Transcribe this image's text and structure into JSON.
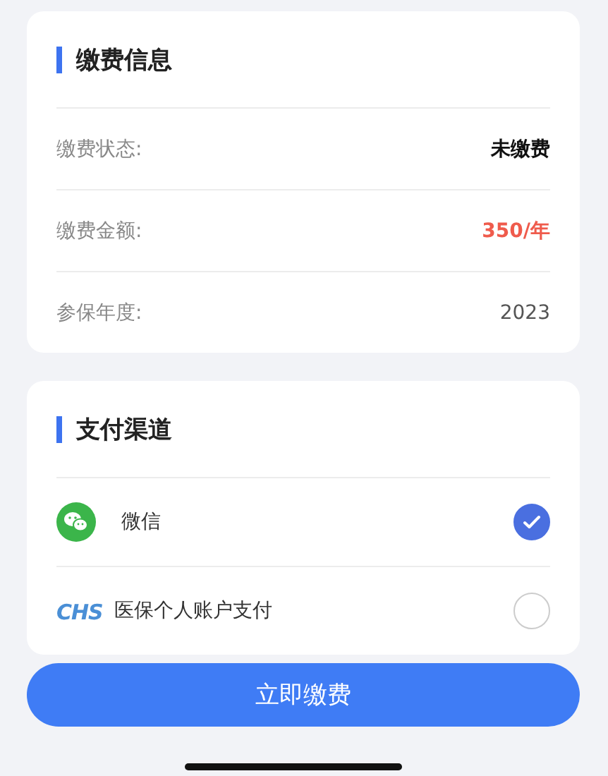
{
  "payment_info": {
    "title": "缴费信息",
    "rows": [
      {
        "label": "缴费状态:",
        "value": "未缴费",
        "kind": "status"
      },
      {
        "label": "缴费金额:",
        "value": "350/年",
        "kind": "amount"
      },
      {
        "label": "参保年度:",
        "value": "2023",
        "kind": "plain"
      }
    ]
  },
  "payment_channels": {
    "title": "支付渠道",
    "items": [
      {
        "label": "微信",
        "kind": "wechat",
        "selected": true
      },
      {
        "label": "医保个人账户支付",
        "kind": "chs",
        "logo_text": "CHS",
        "selected": false
      }
    ]
  },
  "pay_button": "立即缴费"
}
